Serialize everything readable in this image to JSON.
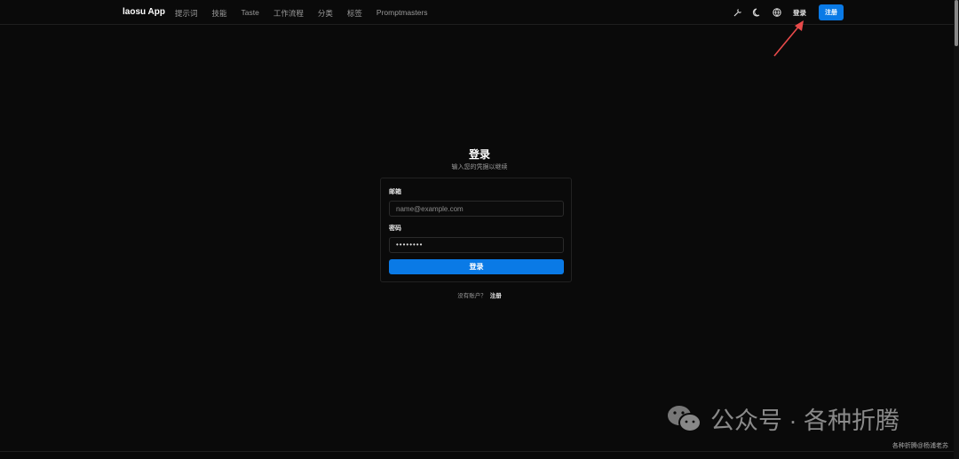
{
  "nav": {
    "brand": "laosu App",
    "links": [
      "提示词",
      "技能",
      "Taste",
      "工作流程",
      "分类",
      "标签",
      "Promptmasters"
    ],
    "login": "登录",
    "register": "注册",
    "icons": [
      "wrench-icon",
      "moon-icon",
      "globe-icon"
    ]
  },
  "form": {
    "title": "登录",
    "subtitle": "输入您的凭据以继续",
    "email_label": "邮箱",
    "email_placeholder": "name@example.com",
    "password_label": "密码",
    "password_value": "••••••••",
    "submit": "登录",
    "no_account": "没有账户？",
    "register_link": "注册"
  },
  "watermark": {
    "main": "公众号 · 各种折腾",
    "credit": "各种折腾@杨浦老苏"
  },
  "colors": {
    "accent": "#0a7ae6",
    "background": "#0a0a0a",
    "arrow": "#e84a4a"
  }
}
